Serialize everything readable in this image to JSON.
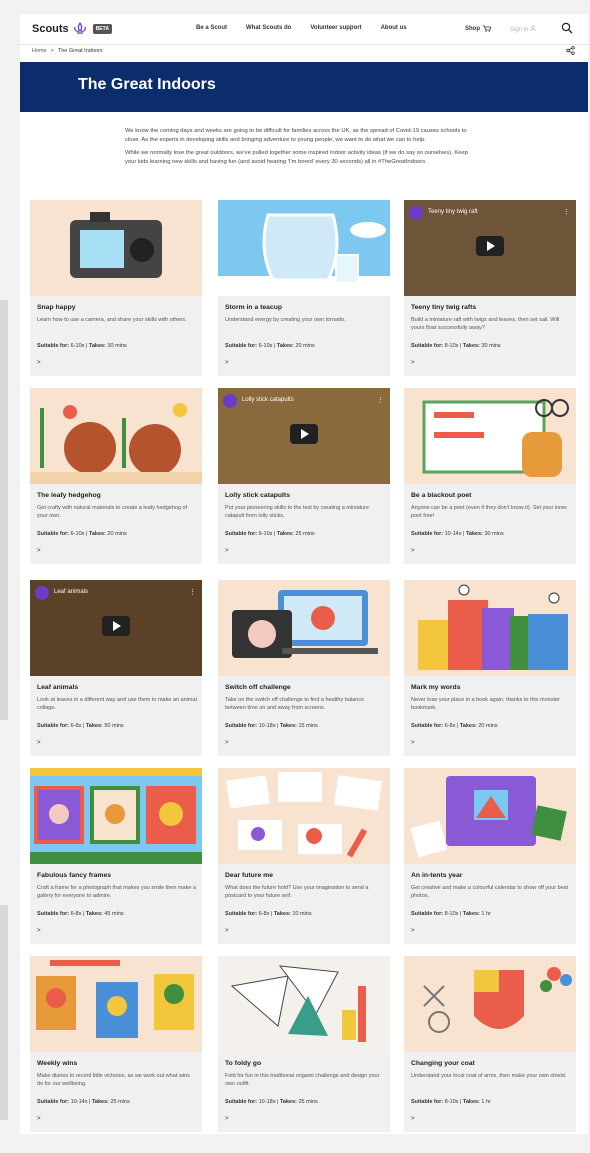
{
  "header": {
    "logo_text": "Scouts",
    "beta": "BETA",
    "nav": [
      "Be a Scout",
      "What Scouts do",
      "Volunteer support",
      "About us"
    ],
    "shop": "Shop",
    "signin": "Sign in"
  },
  "breadcrumb": {
    "home": "Home",
    "sep": ">",
    "current": "The Great Indoors"
  },
  "hero": {
    "title": "The Great Indoors",
    "bg_color": "#0c2d6b"
  },
  "intro": {
    "p1": "We know the coming days and weeks are going to be difficult for families across the UK, as the spread of Covid-19 causes schools to close. As the experts in developing skills and bringing adventure to young people, we want to do what we can to help.",
    "p2": "While we normally love the great outdoors, we've pulled together some inspired indoor activity ideas (if we do say so ourselves). Keep your kids learning new skills and having fun (and avoid hearing 'I'm bored' every 30 seconds) all in #TheGreatIndoors."
  },
  "labels": {
    "suitable": "Suitable for:",
    "takes": "Takes:",
    "arrow": ">"
  },
  "cards": [
    {
      "title": "Snap happy",
      "desc": "Learn how to use a camera, and share your skills with others.",
      "suitable": "6-10s",
      "takes": "30 mins",
      "bg": "#f7e3cf",
      "video": ""
    },
    {
      "title": "Storm in a teacup",
      "desc": "Understand energy by creating your own tornado.",
      "suitable": "6-10s",
      "takes": "20 mins",
      "bg": "#7cc8f0",
      "video": ""
    },
    {
      "title": "Teeny tiny twig rafts",
      "desc": "Build a miniature raft with twigs and leaves, then set sail. Will yours float successfully away?",
      "suitable": "8-10s",
      "takes": "30 mins",
      "bg": "#6e5438",
      "video": "Teeny tiny twig raft"
    },
    {
      "title": "The leafy hedgehog",
      "desc": "Get crafty with natural materials to create a leafy hedgehog of your own.",
      "suitable": "6-10s",
      "takes": "20 mins",
      "bg": "#f7e3cf",
      "video": ""
    },
    {
      "title": "Lolly stick catapults",
      "desc": "Put your pioneering skills to the test by creating a miniature catapult from lolly sticks.",
      "suitable": "6-10s",
      "takes": "25 mins",
      "bg": "#8a6a3c",
      "video": "Lolly stick catapults"
    },
    {
      "title": "Be a blackout poet",
      "desc": "Anyone can be a poet (even if they don't know it). Set your inner poet free!",
      "suitable": "10-14s",
      "takes": "30 mins",
      "bg": "#f7e3cf",
      "video": ""
    },
    {
      "title": "Leaf animals",
      "desc": "Look at leaves in a different way and use them to make an animal collage.",
      "suitable": "6-8s",
      "takes": "50 mins",
      "bg": "#5a4128",
      "video": "Leaf animals"
    },
    {
      "title": "Switch off challenge",
      "desc": "Take on the switch off challenge to find a healthy balance between time on and away from screens.",
      "suitable": "10-18s",
      "takes": "15 mins",
      "bg": "#f7e3cf",
      "video": ""
    },
    {
      "title": "Mark my words",
      "desc": "Never lose your place in a book again, thanks to this monster bookmark.",
      "suitable": "6-8s",
      "takes": "20 mins",
      "bg": "#f7e3cf",
      "video": ""
    },
    {
      "title": "Fabulous fancy frames",
      "desc": "Craft a frame for a photograph that makes you smile then make a gallery for everyone to admire.",
      "suitable": "6-8s",
      "takes": "45 mins",
      "bg": "#7cc8f0",
      "video": ""
    },
    {
      "title": "Dear future me",
      "desc": "What does the future hold? Use your imagination to send a postcard to your future self.",
      "suitable": "6-8s",
      "takes": "10 mins",
      "bg": "#f7e3cf",
      "video": ""
    },
    {
      "title": "An in-tents year",
      "desc": "Get creative and make a colourful calendar to show off your best photos.",
      "suitable": "8-10s",
      "takes": "1 hr",
      "bg": "#f7e3cf",
      "video": ""
    },
    {
      "title": "Weekly wins",
      "desc": "Make diaries to record little victories, as we work out what wins do for our wellbeing.",
      "suitable": "10-14s",
      "takes": "25 mins",
      "bg": "#f7e3cf",
      "video": ""
    },
    {
      "title": "To foldy go",
      "desc": "Fold for fun in this traditional origami challenge and design your own outfit.",
      "suitable": "10-18s",
      "takes": "25 mins",
      "bg": "#f7e3cf",
      "video": ""
    },
    {
      "title": "Changing your coat",
      "desc": "Understand your local coat of arms, then make your own shield.",
      "suitable": "8-10s",
      "takes": "1 hr",
      "bg": "#f7e3cf",
      "video": ""
    }
  ]
}
